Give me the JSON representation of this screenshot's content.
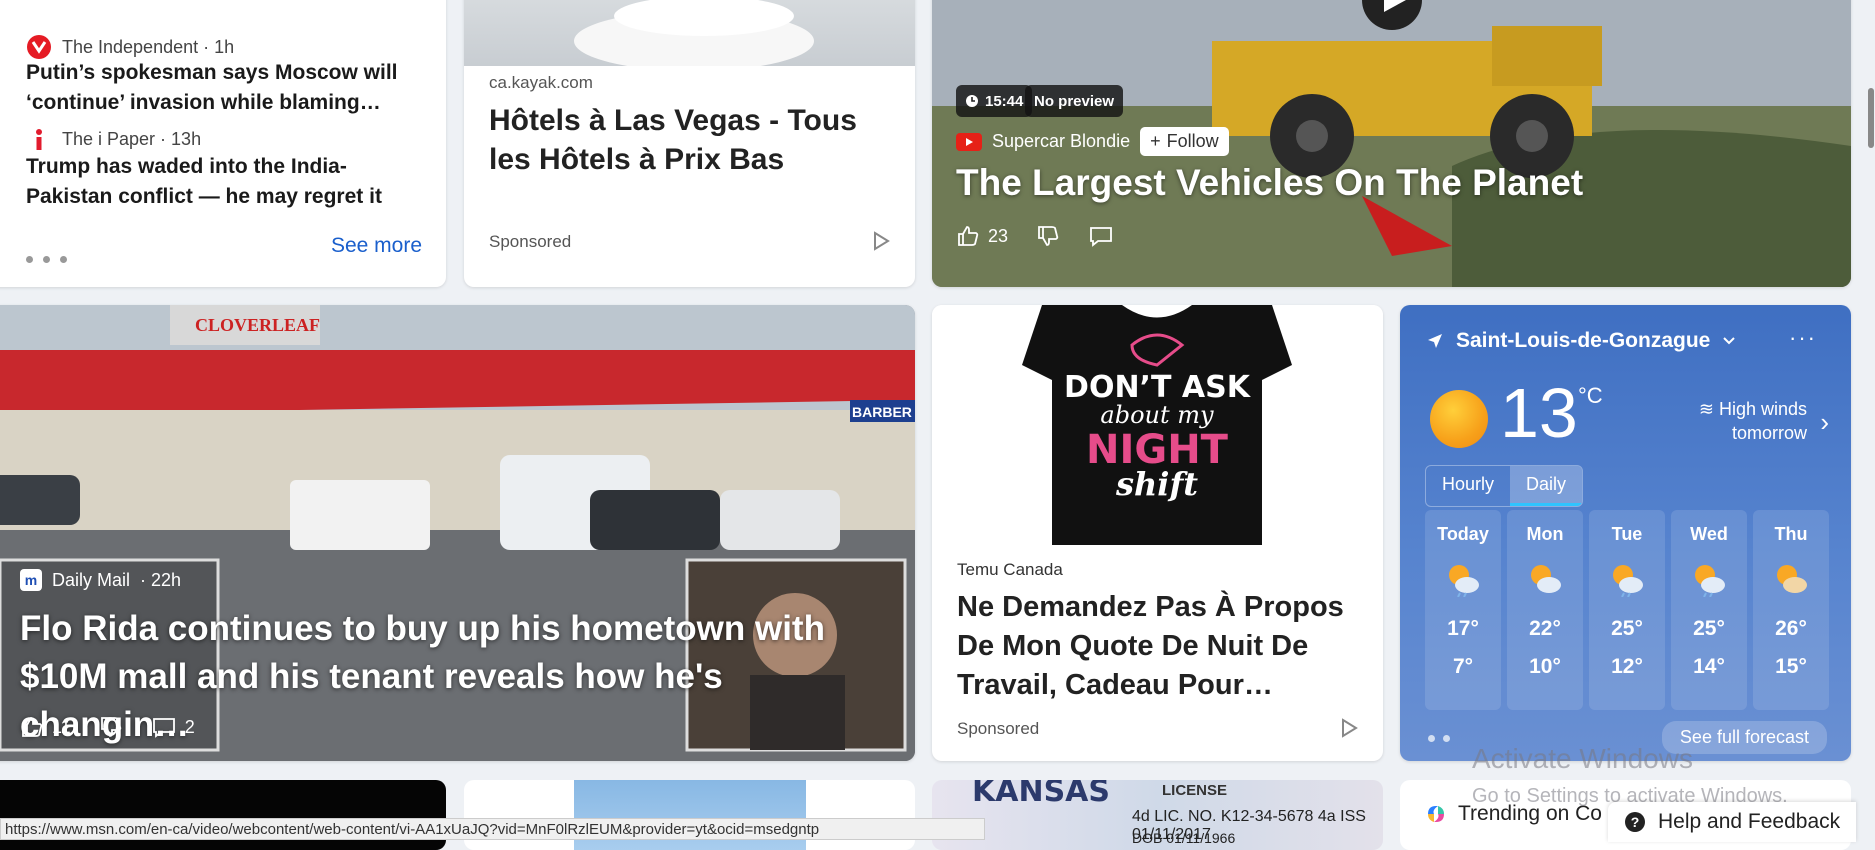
{
  "news_list": {
    "items": [
      {
        "source": "The Independent · 1h",
        "title": "Putin’s spokesman says Moscow will ‘continue’ invasion while blaming…"
      },
      {
        "source": "The i Paper · 13h",
        "title": "Trump has waded into the India-Pakistan conflict — he may regret it"
      }
    ],
    "see_more": "See more"
  },
  "kayak_ad": {
    "domain": "ca.kayak.com",
    "title": "Hôtels à Las Vegas - Tous les Hôtels à Prix Bas",
    "sponsored": "Sponsored"
  },
  "video_card": {
    "duration": "15:44",
    "preview": "No preview",
    "source": "Supercar Blondie",
    "follow": "Follow",
    "title": "The Largest Vehicles On The Planet",
    "likes": "23"
  },
  "florida_card": {
    "source": "Daily Mail",
    "time": "· 22h",
    "title": "Flo Rida continues to buy up his hometown with $10M mall and his tenant reveals how he's changin…",
    "likes": "11",
    "comments": "2",
    "sign_text": "CLOVERLEAF",
    "store_text": "BARBER"
  },
  "temu_ad": {
    "shirt_lines": [
      "DON’T ASK",
      "about my",
      "NIGHT",
      "shift"
    ],
    "source": "Temu Canada",
    "title": "Ne Demandez Pas À Propos De Mon Quote De Nuit De Travail, Cadeau Pour…",
    "sponsored": "Sponsored"
  },
  "weather": {
    "location": "Saint-Louis-de-Gonzague",
    "temp": "13",
    "unit": "°C",
    "alert_line1": "High winds",
    "alert_line2": "tomorrow",
    "tabs": [
      "Hourly",
      "Daily"
    ],
    "days": [
      {
        "name": "Today",
        "hi": "17°",
        "lo": "7°"
      },
      {
        "name": "Mon",
        "hi": "22°",
        "lo": "10°"
      },
      {
        "name": "Tue",
        "hi": "25°",
        "lo": "12°"
      },
      {
        "name": "Wed",
        "hi": "25°",
        "lo": "14°"
      },
      {
        "name": "Thu",
        "hi": "26°",
        "lo": "15°"
      }
    ],
    "forecast_button": "See full forecast"
  },
  "bottom_row": {
    "kansas": "KANSAS",
    "license": "LICENSE",
    "license_line1": "4d LIC. NO. K12-34-5678  4a ISS 01/11/2017",
    "license_line2": "DOB 01/11/1966",
    "trending": "Trending on Co"
  },
  "status_url": "https://www.msn.com/en-ca/video/webcontent/web-content/vi-AA1xUaJQ?vid=MnF0lRzlEUM&provider=yt&ocid=msedgntp",
  "activate_windows": {
    "line1": "Activate Windows",
    "line2": "Go to Settings to activate Windows."
  },
  "help_feedback": "Help and Feedback",
  "colors": {
    "link_blue": "#1a5fcc",
    "weather_blue": "#4a78c8",
    "youtube_red": "#e62117"
  }
}
